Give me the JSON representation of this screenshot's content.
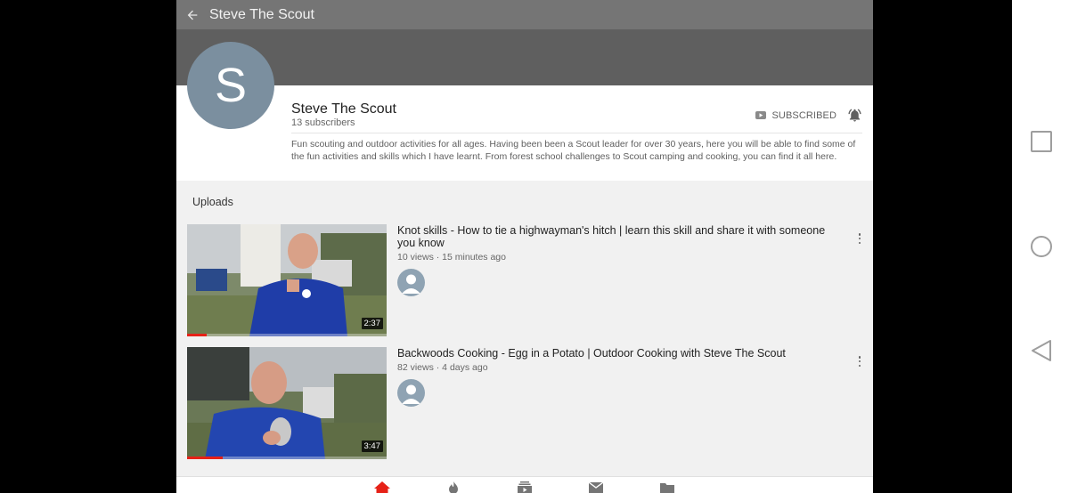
{
  "topbar": {
    "title": "Steve The Scout"
  },
  "channel": {
    "avatar_letter": "S",
    "name": "Steve The Scout",
    "subscribers": "13 subscribers",
    "subscribe_label": "SUBSCRIBED",
    "description": "Fun scouting and outdoor activities for all ages. Having been been a Scout leader for over 30 years, here you will be able to find some of the fun activities and skills which I have learnt. From forest school challenges to Scout camping and cooking, you can find it all here."
  },
  "uploads": {
    "header": "Uploads",
    "videos": [
      {
        "title": "Knot skills - How to tie a highwayman's hitch | learn this skill and share it with someone you know",
        "meta": "10 views · 15 minutes ago",
        "duration": "2:37",
        "watched_fraction": 0.1
      },
      {
        "title": "Backwoods Cooking - Egg in a Potato | Outdoor Cooking with Steve The Scout",
        "meta": "82 views · 4 days ago",
        "duration": "3:47",
        "watched_fraction": 0.18
      }
    ]
  },
  "bottom_nav": {
    "items": [
      "home-icon",
      "trending-icon",
      "subscriptions-icon",
      "inbox-icon",
      "library-icon"
    ],
    "active": "home-icon"
  },
  "system_nav": {
    "items": [
      "recents-icon",
      "home-circle-icon",
      "back-triangle-icon"
    ]
  },
  "colors": {
    "accent": "#e62117",
    "topbar": "#757575",
    "banner": "#5f5f5f",
    "avatar": "#7b8f9f"
  }
}
